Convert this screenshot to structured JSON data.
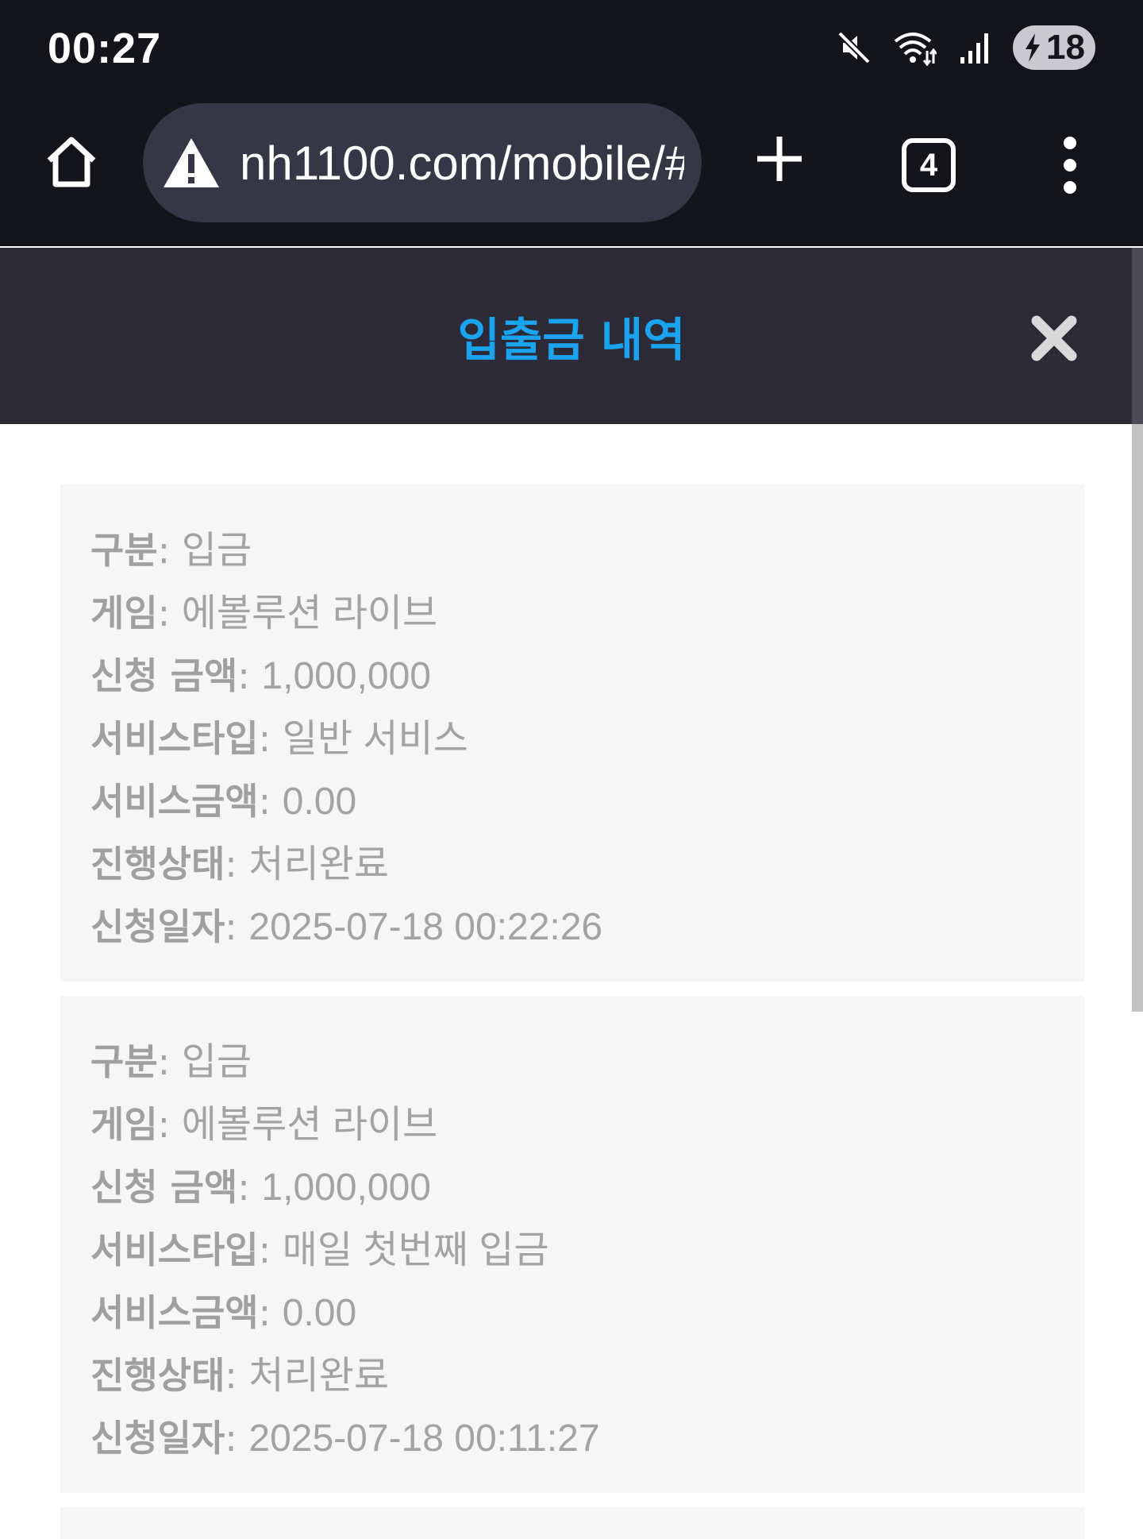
{
  "status_bar": {
    "time": "00:27",
    "icons": [
      "mute-icon",
      "wifi-icon",
      "signal-icon"
    ],
    "battery": "18"
  },
  "browser": {
    "url": "nh1100.com/mobile/#",
    "tab_count": "4",
    "icons": [
      "home-icon",
      "warning-icon",
      "plus-icon",
      "more-vertical-icon"
    ]
  },
  "page": {
    "title": "입출금 내역",
    "close_icon": "close-icon",
    "accent_color": "#1aa3ee"
  },
  "records": [
    {
      "rows": [
        {
          "label": "구분",
          "value": "입금"
        },
        {
          "label": "게임",
          "value": "에볼루션 라이브"
        },
        {
          "label": "신청 금액",
          "value": "1,000,000"
        },
        {
          "label": "서비스타입",
          "value": "일반 서비스"
        },
        {
          "label": "서비스금액",
          "value": "0.00"
        },
        {
          "label": "진행상태",
          "value": "처리완료"
        },
        {
          "label": "신청일자",
          "value": "2025-07-18 00:22:26"
        }
      ]
    },
    {
      "rows": [
        {
          "label": "구분",
          "value": "입금"
        },
        {
          "label": "게임",
          "value": "에볼루션 라이브"
        },
        {
          "label": "신청 금액",
          "value": "1,000,000"
        },
        {
          "label": "서비스타입",
          "value": "매일 첫번째 입금"
        },
        {
          "label": "서비스금액",
          "value": "0.00"
        },
        {
          "label": "진행상태",
          "value": "처리완료"
        },
        {
          "label": "신청일자",
          "value": "2025-07-18 00:11:27"
        }
      ]
    }
  ]
}
